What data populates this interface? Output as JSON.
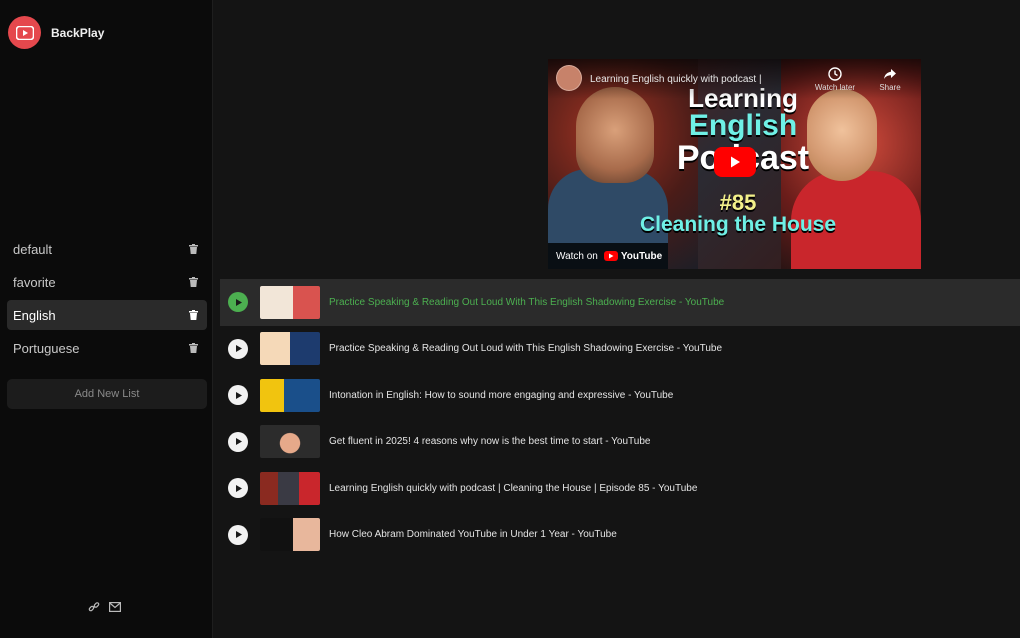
{
  "app": {
    "name": "BackPlay",
    "accent": "#e5484d",
    "active_color": "#4caf50"
  },
  "sidebar": {
    "lists": [
      {
        "label": "default"
      },
      {
        "label": "favorite"
      },
      {
        "label": "English",
        "active": true
      },
      {
        "label": "Portuguese"
      }
    ],
    "add_list_label": "Add New List",
    "footer_icons": [
      "link-icon",
      "mail-icon"
    ]
  },
  "player": {
    "video_title": "Learning English quickly with podcast |",
    "watch_later_label": "Watch later",
    "share_label": "Share",
    "thumbnail_line1": "Learning",
    "thumbnail_line2": "English",
    "thumbnail_line3": "Podcast",
    "thumbnail_episode": "#85",
    "thumbnail_subtitle": "Cleaning the House",
    "watch_on_label": "Watch on",
    "youtube_label": "YouTube"
  },
  "playlist": [
    {
      "title": "Practice Speaking & Reading Out Loud With This English Shadowing Exercise - YouTube",
      "active": true,
      "thumb": [
        "#f2e6d8",
        "#d9534f"
      ]
    },
    {
      "title": "Practice Speaking & Reading Out Loud with This English Shadowing Exercise - YouTube",
      "active": false,
      "thumb": [
        "#1d3b6e",
        "#f5d9b8"
      ]
    },
    {
      "title": "Intonation in English: How to sound more engaging and expressive - YouTube",
      "active": false,
      "thumb": [
        "#1a4f8a",
        "#f1c40f"
      ]
    },
    {
      "title": "Get fluent in 2025! 4 reasons why now is the best time to start - YouTube",
      "active": false,
      "thumb": [
        "#2c2c2c",
        "#f4d03f"
      ]
    },
    {
      "title": "Learning English quickly with podcast | Cleaning the House | Episode 85 - YouTube",
      "active": false,
      "thumb": [
        "#8a2a20",
        "#6ff0e6"
      ]
    },
    {
      "title": "How Cleo Abram Dominated YouTube in Under 1 Year - YouTube",
      "active": false,
      "thumb": [
        "#111111",
        "#f7e94a"
      ]
    }
  ]
}
